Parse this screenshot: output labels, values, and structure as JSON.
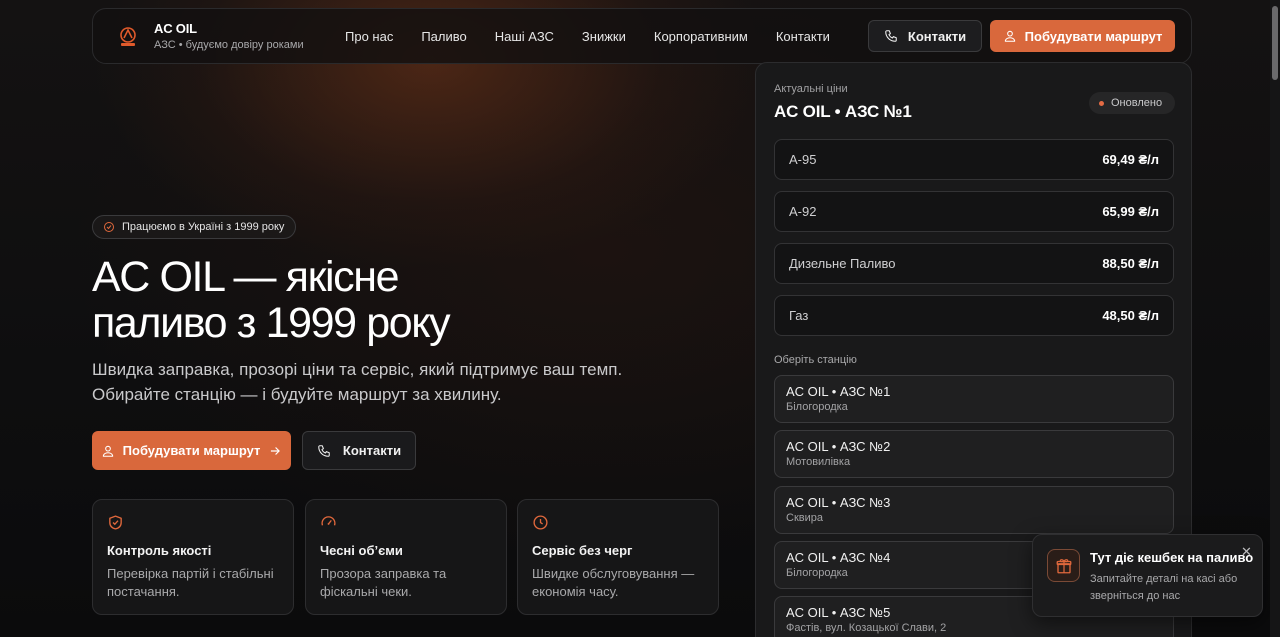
{
  "header": {
    "brand_name": "AC OIL",
    "brand_tagline": "АЗС • будуємо довіру роками",
    "menu": [
      "Про нас",
      "Паливо",
      "Наші АЗС",
      "Знижки",
      "Корпоративним",
      "Контакти"
    ],
    "contacts_button": "Контакти",
    "route_button": "Побудувати маршрут"
  },
  "hero": {
    "badge": "Працюємо в Україні з 1999 року",
    "title_line1": "AC OIL — якісне",
    "title_line2": "паливо з 1999 року",
    "subtitle_line1": "Швидка заправка, прозорі ціни та сервіс, який підтримує ваш темп.",
    "subtitle_line2": "Обирайте станцію — і будуйте маршрут за хвилину.",
    "route_button": "Побудувати маршрут",
    "contacts_button": "Контакти"
  },
  "features": [
    {
      "icon": "shield-check-icon",
      "title": "Контроль якості",
      "text": "Перевірка партій і стабільні постачання."
    },
    {
      "icon": "gauge-icon",
      "title": "Чесні об’єми",
      "text": "Прозора заправка та фіскальні чеки."
    },
    {
      "icon": "clock-icon",
      "title": "Сервіс без черг",
      "text": "Швидке обслуговування — економія часу."
    }
  ],
  "prices": {
    "label": "Актуальні ціни",
    "station_title": "AC OIL • АЗС №1",
    "status": "Оновлено",
    "rows": [
      {
        "fuel": "А-95",
        "price": "69,49 ₴/л"
      },
      {
        "fuel": "А-92",
        "price": "65,99 ₴/л"
      },
      {
        "fuel": "Дизельне Паливо",
        "price": "88,50 ₴/л"
      },
      {
        "fuel": "Газ",
        "price": "48,50 ₴/л"
      }
    ]
  },
  "stations": {
    "label": "Оберіть станцію",
    "items": [
      {
        "name": "AC OIL • АЗС №1",
        "address": "Білогородка"
      },
      {
        "name": "AC OIL • АЗС №2",
        "address": "Мотовилівка"
      },
      {
        "name": "AC OIL • АЗС №3",
        "address": "Сквира"
      },
      {
        "name": "AC OIL • АЗС №4",
        "address": "Білогородка"
      },
      {
        "name": "AC OIL • АЗС №5",
        "address": "Фастів, вул. Козацької Слави, 2"
      }
    ]
  },
  "toast": {
    "title": "Тут діє кешбек на паливо",
    "text": "Запитайте деталі на касі або зверніться до нас",
    "close": "✕"
  },
  "colors": {
    "accent": "#d9683c",
    "background": "#0d0d0e",
    "status_dot": "#e46b44"
  }
}
